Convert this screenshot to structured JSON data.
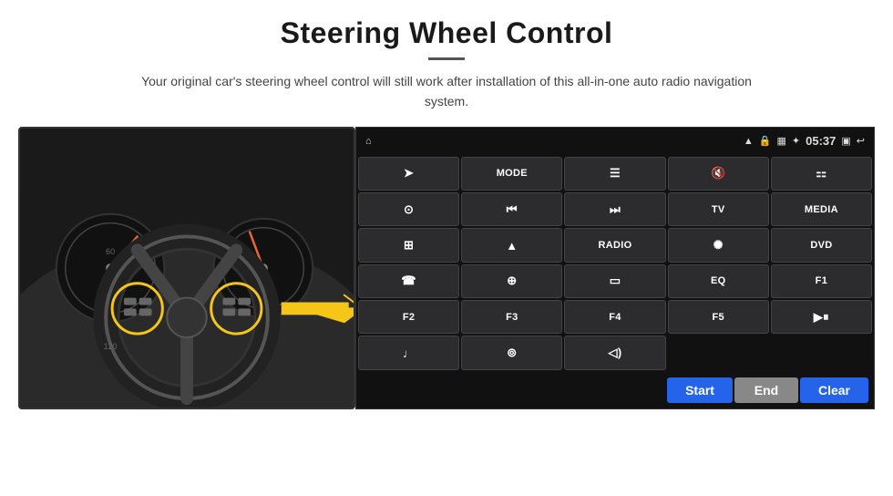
{
  "page": {
    "title": "Steering Wheel Control",
    "subtitle": "Your original car's steering wheel control will still work after installation of this all-in-one auto radio navigation system."
  },
  "status_bar": {
    "time": "05:37",
    "icons": [
      "wifi",
      "lock",
      "sim",
      "bluetooth",
      "home",
      "back"
    ]
  },
  "button_grid": [
    {
      "id": "r1c1",
      "type": "icon",
      "icon": "⬆",
      "label": "navigate"
    },
    {
      "id": "r1c2",
      "type": "text",
      "icon": "",
      "label": "MODE"
    },
    {
      "id": "r1c3",
      "type": "icon",
      "icon": "≡",
      "label": "menu"
    },
    {
      "id": "r1c4",
      "type": "icon",
      "icon": "🔇",
      "label": "mute"
    },
    {
      "id": "r1c5",
      "type": "icon",
      "icon": "⠿",
      "label": "apps"
    },
    {
      "id": "r2c1",
      "type": "icon",
      "icon": "⊙",
      "label": "settings"
    },
    {
      "id": "r2c2",
      "type": "icon",
      "icon": "⏮",
      "label": "prev"
    },
    {
      "id": "r2c3",
      "type": "icon",
      "icon": "⏭",
      "label": "next"
    },
    {
      "id": "r2c4",
      "type": "text",
      "icon": "",
      "label": "TV"
    },
    {
      "id": "r2c5",
      "type": "text",
      "icon": "",
      "label": "MEDIA"
    },
    {
      "id": "r3c1",
      "type": "icon",
      "icon": "📷",
      "label": "camera360"
    },
    {
      "id": "r3c2",
      "type": "icon",
      "icon": "▲",
      "label": "eject"
    },
    {
      "id": "r3c3",
      "type": "text",
      "icon": "",
      "label": "RADIO"
    },
    {
      "id": "r3c4",
      "type": "icon",
      "icon": "☼",
      "label": "brightness"
    },
    {
      "id": "r3c5",
      "type": "text",
      "icon": "",
      "label": "DVD"
    },
    {
      "id": "r4c1",
      "type": "icon",
      "icon": "📞",
      "label": "call"
    },
    {
      "id": "r4c2",
      "type": "icon",
      "icon": "◎",
      "label": "gps"
    },
    {
      "id": "r4c3",
      "type": "icon",
      "icon": "▬",
      "label": "panel"
    },
    {
      "id": "r4c4",
      "type": "text",
      "icon": "",
      "label": "EQ"
    },
    {
      "id": "r4c5",
      "type": "text",
      "icon": "",
      "label": "F1"
    },
    {
      "id": "r5c1",
      "type": "text",
      "icon": "",
      "label": "F2"
    },
    {
      "id": "r5c2",
      "type": "text",
      "icon": "",
      "label": "F3"
    },
    {
      "id": "r5c3",
      "type": "text",
      "icon": "",
      "label": "F4"
    },
    {
      "id": "r5c4",
      "type": "text",
      "icon": "",
      "label": "F5"
    },
    {
      "id": "r5c5",
      "type": "icon",
      "icon": "⏯",
      "label": "playpause"
    },
    {
      "id": "r6c1",
      "type": "icon",
      "icon": "♪",
      "label": "music"
    },
    {
      "id": "r6c2",
      "type": "icon",
      "icon": "🎤",
      "label": "mic"
    },
    {
      "id": "r6c3",
      "type": "icon",
      "icon": "🔈",
      "label": "volume"
    },
    {
      "id": "r6c4",
      "type": "empty",
      "icon": "",
      "label": ""
    },
    {
      "id": "r6c5",
      "type": "empty",
      "icon": "",
      "label": ""
    }
  ],
  "bottom_buttons": {
    "start": "Start",
    "end": "End",
    "clear": "Clear"
  }
}
